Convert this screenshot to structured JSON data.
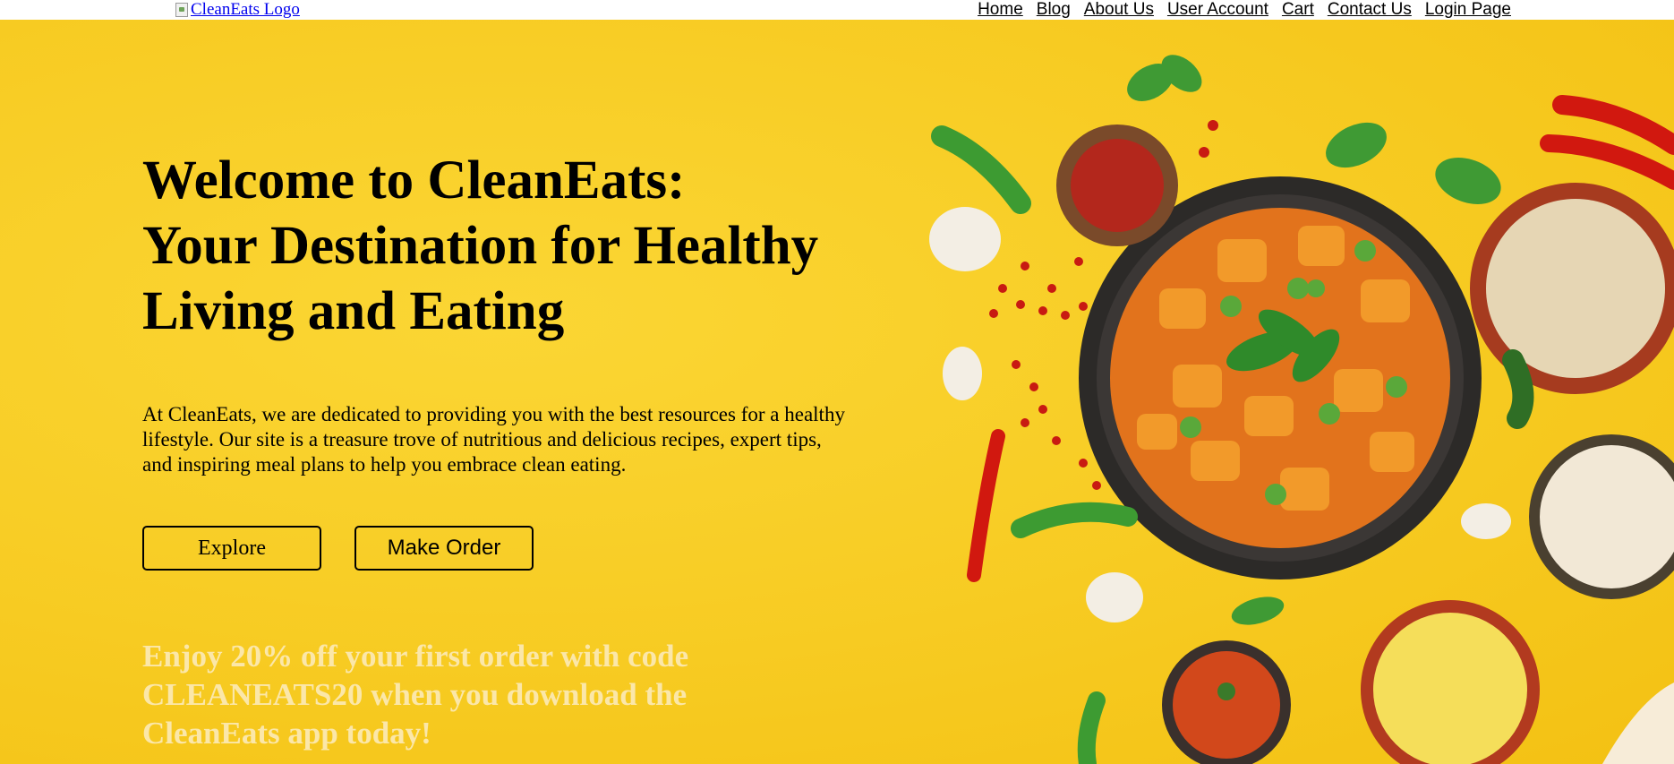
{
  "header": {
    "logo_alt": "CleanEats Logo",
    "nav": [
      "Home",
      "Blog",
      "About Us",
      "User Account",
      "Cart",
      "Contact Us",
      "Login Page"
    ]
  },
  "hero": {
    "title_lines": [
      "Welcome to CleanEats:",
      "Your Destination for Healthy",
      "Living and Eating"
    ],
    "intro": "At CleanEats, we are dedicated to providing you with the best resources for a healthy lifestyle. Our site is a treasure trove of nutritious and delicious recipes, expert tips, and inspiring meal plans to help you embrace clean eating.",
    "buttons": {
      "explore": "Explore",
      "order": "Make Order"
    },
    "promo": "Enjoy 20% off your first order with code CLEANEATS20 when you download the CleanEats app today!"
  },
  "colors": {
    "hero_background": "#f7cb22",
    "promo_text": "#fbe7a9",
    "link": "#0000ee"
  },
  "icons": [
    "broken-image-icon",
    "food-illustration"
  ]
}
